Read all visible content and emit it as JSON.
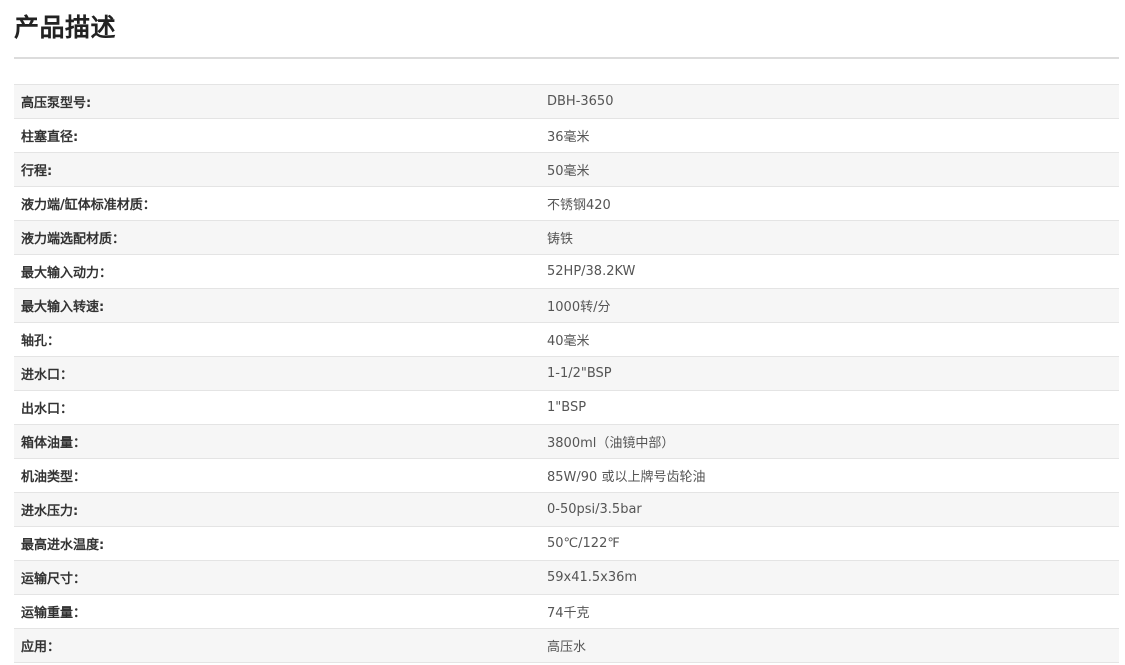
{
  "section": {
    "title": "产品描述"
  },
  "specs": [
    {
      "label": "高压泵型号:",
      "value": "DBH-3650"
    },
    {
      "label": "柱塞直径:",
      "value": "36毫米"
    },
    {
      "label": "行程:",
      "value": "50毫米"
    },
    {
      "label": "液力端/缸体标准材质：",
      "value": "不锈钢420"
    },
    {
      "label": "液力端选配材质：",
      "value": "铸铁"
    },
    {
      "label": "最大输入动力：",
      "value": "52HP/38.2KW"
    },
    {
      "label": "最大输入转速:",
      "value": "1000转/分"
    },
    {
      "label": "轴孔：",
      "value": "40毫米"
    },
    {
      "label": "进水口：",
      "value": "1-1/2\"BSP"
    },
    {
      "label": "出水口：",
      "value": "1\"BSP"
    },
    {
      "label": "箱体油量：",
      "value": "3800ml（油镜中部）"
    },
    {
      "label": "机油类型：",
      "value": "85W/90 或以上牌号齿轮油"
    },
    {
      "label": "进水压力:",
      "value": "0-50psi/3.5bar"
    },
    {
      "label": "最高进水温度:",
      "value": "50℃/122℉"
    },
    {
      "label": "运输尺寸：",
      "value": "59x41.5x36m"
    },
    {
      "label": "运输重量：",
      "value": "74千克"
    },
    {
      "label": "应用：",
      "value": "高压水"
    }
  ]
}
